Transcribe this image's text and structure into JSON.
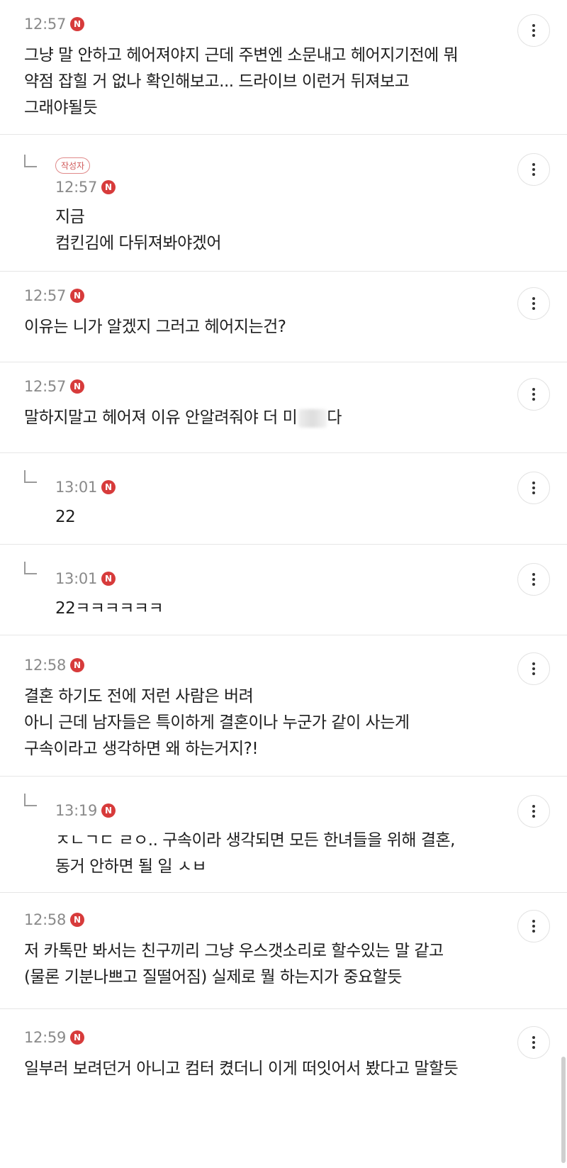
{
  "badge_letter": "N",
  "author_label": "작성자",
  "comments": [
    {
      "time": "12:57",
      "reply": false,
      "lines": [
        "그냥 말 안하고 헤어져야지 근데 주변엔 소문내고 헤어지기전에 뭐",
        "약점 잡힐 거 없나 확인해보고... 드라이브 이런거 뒤져보고",
        "그래야될듯"
      ]
    },
    {
      "time": "12:57",
      "reply": true,
      "author": true,
      "lines": [
        "지금",
        "컴킨김에 다뒤져봐야겠어"
      ]
    },
    {
      "time": "12:57",
      "reply": false,
      "lines": [
        "이유는 니가 알겠지 그러고 헤어지는건?"
      ]
    },
    {
      "time": "12:57",
      "reply": false,
      "lines": [
        "말하지말고 헤어져 이유 안알려줘야 더 미"
      ],
      "tail": "다"
    },
    {
      "time": "13:01",
      "reply": true,
      "lines": [
        "22"
      ]
    },
    {
      "time": "13:01",
      "reply": true,
      "lines": [
        "22ㅋㅋㅋㅋㅋㅋ"
      ]
    },
    {
      "time": "12:58",
      "reply": false,
      "lines": [
        "결혼 하기도 전에 저런 사람은 버려",
        "아니 근데 남자들은 특이하게 결혼이나 누군가 같이 사는게",
        "구속이라고 생각하면 왜 하는거지?!"
      ]
    },
    {
      "time": "13:19",
      "reply": true,
      "lines": [
        "ㅈㄴㄱㄷ ㄹㅇ.. 구속이라 생각되면 모든 한녀들을 위해 결혼,",
        "동거 안하면 될 일 ㅅㅂ"
      ]
    },
    {
      "time": "12:58",
      "reply": false,
      "lines": [
        "저 카톡만 봐서는 친구끼리 그냥 우스갯소리로 할수있는 말 같고",
        "(물론 기분나쁘고 질떨어짐) 실제로 뭘 하는지가 중요할듯"
      ]
    },
    {
      "time": "12:59",
      "reply": false,
      "lines": [
        "일부러 보려던거 아니고 컴터 켰더니 이게 떠잇어서 봤다고 말할듯"
      ]
    }
  ]
}
